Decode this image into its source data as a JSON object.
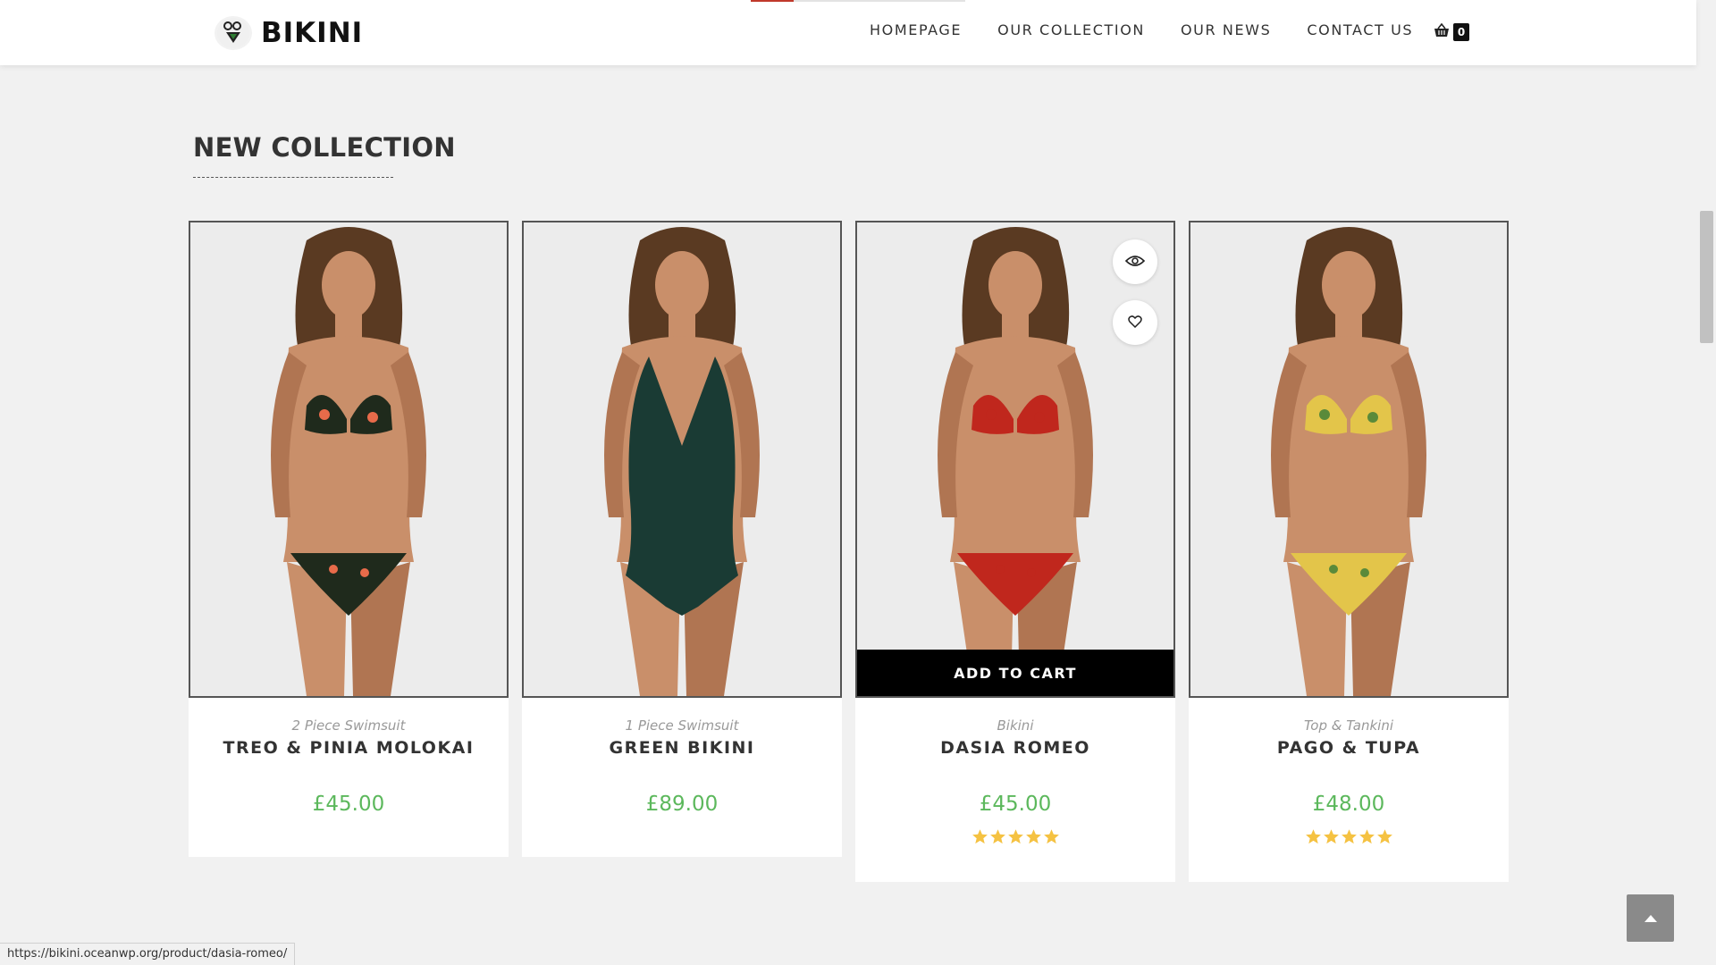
{
  "header": {
    "logo_text": "BIKINI",
    "nav": [
      "HOMEPAGE",
      "OUR COLLECTION",
      "OUR NEWS",
      "CONTACT US"
    ],
    "cart_count": "0"
  },
  "section": {
    "title": "NEW COLLECTION"
  },
  "products": [
    {
      "category": "2 Piece Swimsuit",
      "name": "TREO & PINIA MOLOKAI",
      "price": "£45.00",
      "rating": null,
      "swimsuit_color": "#1f2a1c",
      "accent_color": "#e86b4a"
    },
    {
      "category": "1 Piece Swimsuit",
      "name": "GREEN BIKINI",
      "price": "£89.00",
      "rating": null,
      "swimsuit_color": "#1a3b34",
      "accent_color": "#1a3b34"
    },
    {
      "category": "Bikini",
      "name": "DASIA ROMEO",
      "price": "£45.00",
      "rating": 5,
      "swimsuit_color": "#c0271d",
      "accent_color": "#c0271d",
      "add_to_cart_label": "ADD TO CART"
    },
    {
      "category": "Top & Tankini",
      "name": "PAGO & TUPA",
      "price": "£48.00",
      "rating": 5,
      "swimsuit_color": "#e3c54a",
      "accent_color": "#5a8a3a"
    }
  ],
  "status_url": "https://bikini.oceanwp.org/product/dasia-romeo/",
  "colors": {
    "price": "#5cb85c",
    "star": "#f5c242",
    "accent": "#000000"
  }
}
